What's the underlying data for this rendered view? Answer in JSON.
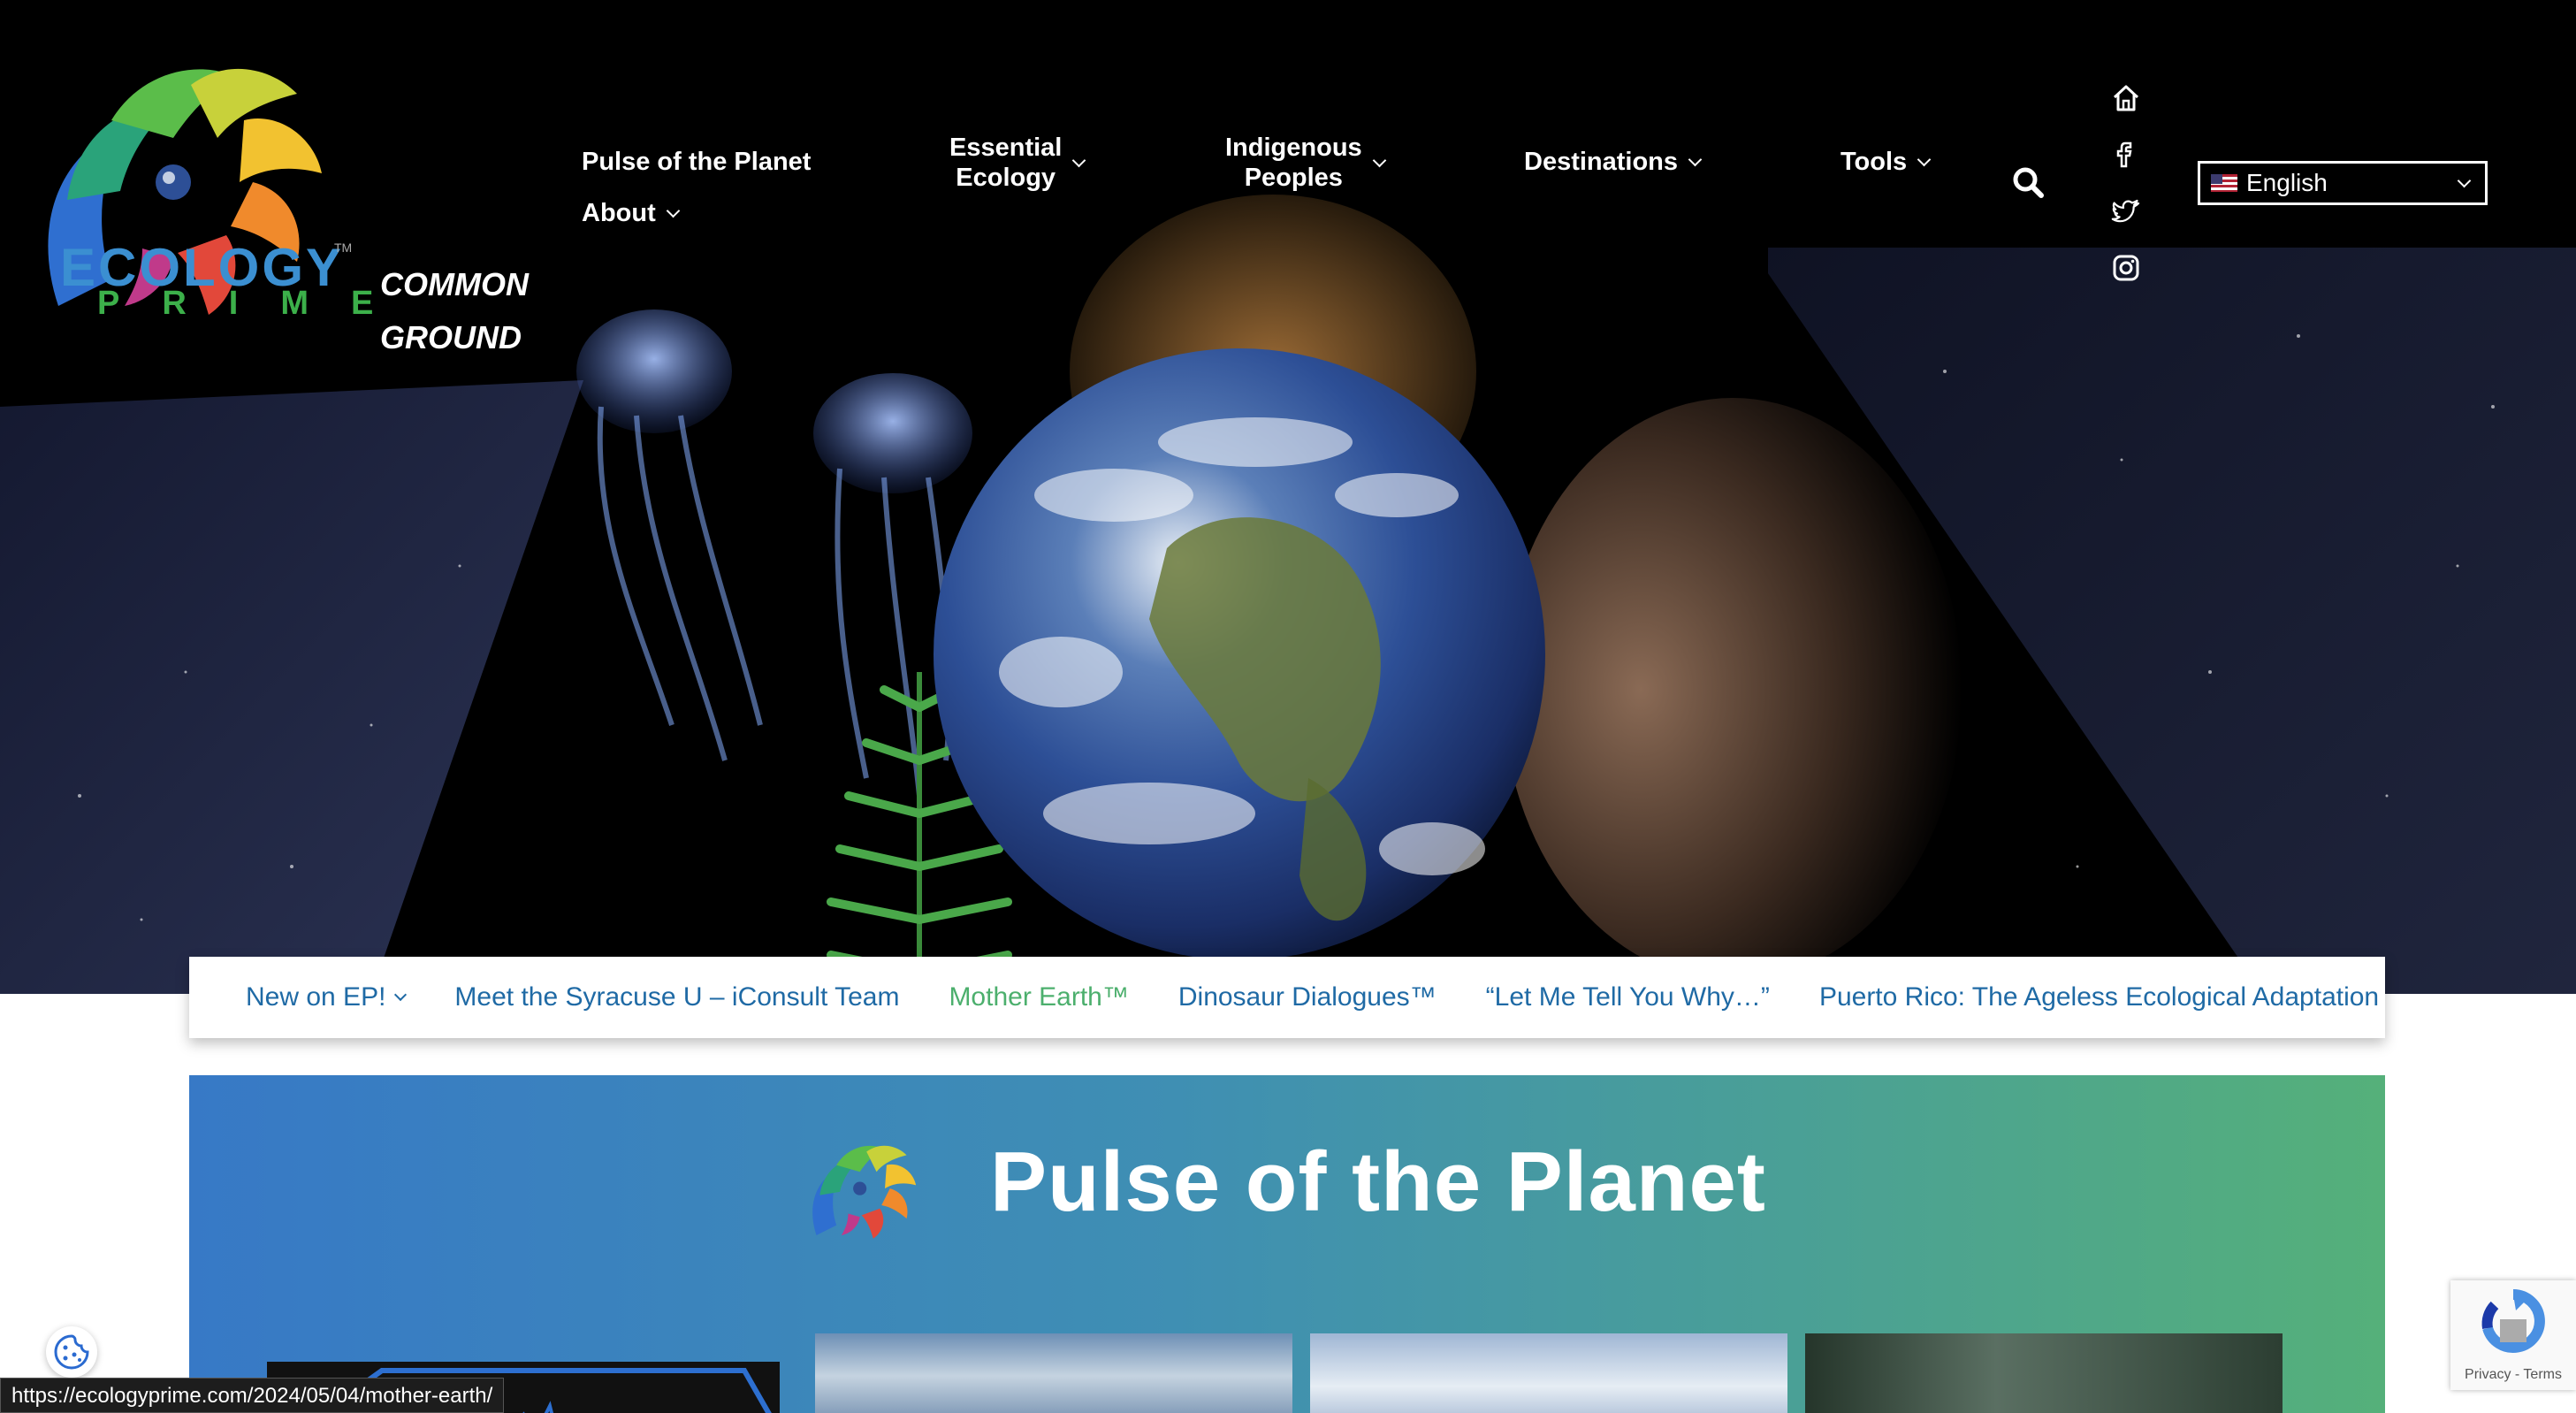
{
  "brand": {
    "logo_line1": "ECOLOGY",
    "logo_line2": "PRIME",
    "trademark": "TM",
    "tagline_line1": "COMMON",
    "tagline_line2": "GROUND",
    "colors": {
      "logo_blue": "#3b8fd1",
      "logo_green": "#3cb04a"
    }
  },
  "nav": {
    "items": [
      {
        "label": "Pulse of the Planet",
        "has_dropdown": false
      },
      {
        "label_line1": "Essential",
        "label_line2": "Ecology",
        "has_dropdown": true
      },
      {
        "label_line1": "Indigenous",
        "label_line2": "Peoples",
        "has_dropdown": true
      },
      {
        "label": "Destinations",
        "has_dropdown": true
      },
      {
        "label": "Tools",
        "has_dropdown": true
      },
      {
        "label": "About",
        "has_dropdown": true
      }
    ],
    "search_icon": "search-icon",
    "social_icons": [
      "home-icon",
      "facebook-icon",
      "twitter-icon",
      "instagram-icon"
    ],
    "language": {
      "selected": "English",
      "flag_icon": "us-flag-icon"
    }
  },
  "subnav": {
    "items": [
      {
        "label": "New on EP!",
        "has_dropdown": true,
        "active": false
      },
      {
        "label": "Meet the Syracuse U – iConsult Team",
        "active": false
      },
      {
        "label": "Mother Earth™",
        "active": true
      },
      {
        "label": "Dinosaur Dialogues™",
        "active": false
      },
      {
        "label": "“Let Me Tell You Why…”",
        "active": false
      },
      {
        "label": "Puerto Rico: The Ageless Ecological Adaptation",
        "active": false
      }
    ],
    "colors": {
      "link": "#1f6aa5",
      "active": "#4caf6d"
    }
  },
  "pulse_section": {
    "title": "Pulse of the Planet",
    "gradient": [
      "#3779c6",
      "#55b07a"
    ]
  },
  "overlays": {
    "status_url": "https://ecologyprime.com/2024/05/04/mother-earth/",
    "recaptcha_text": "Privacy - Terms",
    "cookie_icon": "cookie-icon"
  }
}
